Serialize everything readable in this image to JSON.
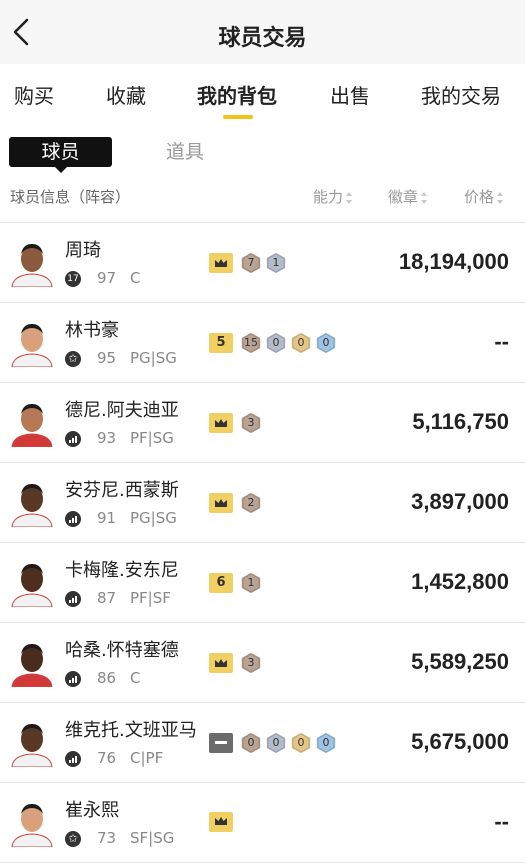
{
  "header": {
    "title": "球员交易"
  },
  "tabs": [
    {
      "label": "购买",
      "active": false
    },
    {
      "label": "收藏",
      "active": false
    },
    {
      "label": "我的背包",
      "active": true
    },
    {
      "label": "出售",
      "active": false
    },
    {
      "label": "我的交易",
      "active": false
    }
  ],
  "subtabs": [
    {
      "label": "球员",
      "active": true
    },
    {
      "label": "道具",
      "active": false
    }
  ],
  "columns": {
    "info": "球员信息（阵容）",
    "ability": "能力",
    "badge": "徽章",
    "price": "价格"
  },
  "colors": {
    "accent": "#f6c21a",
    "crown_badge": "#f1cf63",
    "hex_bronze": "#b9a394",
    "hex_silver": "#b4bccb",
    "hex_gold": "#e3c68a",
    "hex_blue": "#9fc3e3"
  },
  "players": [
    {
      "name": "周琦",
      "icon": "17",
      "rating": "97",
      "position": "C",
      "square": {
        "type": "crown"
      },
      "hexes": [
        {
          "v": "7",
          "c": "bronze"
        },
        {
          "v": "1",
          "c": "silver"
        }
      ],
      "price": "18,194,000"
    },
    {
      "name": "林书豪",
      "icon": "star",
      "rating": "95",
      "position": "PG|SG",
      "square": {
        "type": "num",
        "v": "5"
      },
      "hexes": [
        {
          "v": "15",
          "c": "bronze"
        },
        {
          "v": "0",
          "c": "silver"
        },
        {
          "v": "0",
          "c": "gold"
        },
        {
          "v": "0",
          "c": "blue"
        }
      ],
      "price": "--"
    },
    {
      "name": "德尼.阿夫迪亚",
      "icon": "bars",
      "rating": "93",
      "position": "PF|SG",
      "square": {
        "type": "crown"
      },
      "hexes": [
        {
          "v": "3",
          "c": "bronze"
        }
      ],
      "price": "5,116,750"
    },
    {
      "name": "安芬尼.西蒙斯",
      "icon": "bars",
      "rating": "91",
      "position": "PG|SG",
      "square": {
        "type": "crown"
      },
      "hexes": [
        {
          "v": "2",
          "c": "bronze"
        }
      ],
      "price": "3,897,000"
    },
    {
      "name": "卡梅隆.安东尼",
      "icon": "bars",
      "rating": "87",
      "position": "PF|SF",
      "square": {
        "type": "num",
        "v": "6"
      },
      "hexes": [
        {
          "v": "1",
          "c": "bronze"
        }
      ],
      "price": "1,452,800"
    },
    {
      "name": "哈桑.怀特塞德",
      "icon": "bars",
      "rating": "86",
      "position": "C",
      "square": {
        "type": "crown"
      },
      "hexes": [
        {
          "v": "3",
          "c": "bronze"
        }
      ],
      "price": "5,589,250"
    },
    {
      "name": "维克托.文班亚马",
      "icon": "bars",
      "rating": "76",
      "position": "C|PF",
      "square": {
        "type": "dash"
      },
      "hexes": [
        {
          "v": "0",
          "c": "bronze"
        },
        {
          "v": "0",
          "c": "silver"
        },
        {
          "v": "0",
          "c": "gold"
        },
        {
          "v": "0",
          "c": "blue"
        }
      ],
      "price": "5,675,000"
    },
    {
      "name": "崔永熙",
      "icon": "star",
      "rating": "73",
      "position": "SF|SG",
      "square": {
        "type": "crown"
      },
      "hexes": [],
      "price": "--"
    }
  ]
}
